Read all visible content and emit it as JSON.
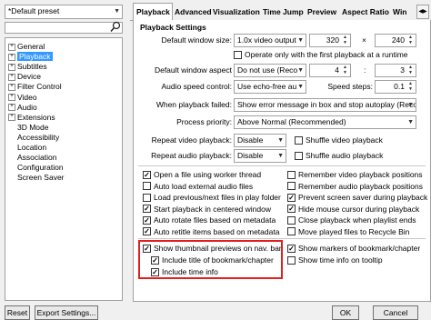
{
  "preset": {
    "value": "*Default preset"
  },
  "search": {
    "icon": "magnifier"
  },
  "tree": {
    "items": [
      {
        "label": "General",
        "expandable": true
      },
      {
        "label": "Playback",
        "expandable": true,
        "selected": true
      },
      {
        "label": "Subtitles",
        "expandable": true
      },
      {
        "label": "Device",
        "expandable": true
      },
      {
        "label": "Filter Control",
        "expandable": true
      },
      {
        "label": "Video",
        "expandable": true
      },
      {
        "label": "Audio",
        "expandable": true
      },
      {
        "label": "Extensions",
        "expandable": true
      },
      {
        "label": "3D Mode",
        "expandable": false
      },
      {
        "label": "Accessibility",
        "expandable": false
      },
      {
        "label": "Location",
        "expandable": false
      },
      {
        "label": "Association",
        "expandable": false
      },
      {
        "label": "Configuration",
        "expandable": false
      },
      {
        "label": "Screen Saver",
        "expandable": false
      }
    ]
  },
  "tabs": [
    "Playback",
    "Advanced",
    "Visualization",
    "Time Jump",
    "Preview",
    "Aspect Ratio",
    "Win"
  ],
  "settings": {
    "group_label": "Playback Settings",
    "window_size_label": "Default window size:",
    "window_size_value": "1.0x video output",
    "width_value": "320",
    "times": "×",
    "height_value": "240",
    "operate_only_label": "Operate only with the first playback at a runtime",
    "aspect_label": "Default window aspect",
    "aspect_value": "Do not use (Reco",
    "aspect_w": "4",
    "aspect_colon": ":",
    "aspect_h": "3",
    "audio_speed_label": "Audio speed control:",
    "audio_speed_value": "Use echo-free au",
    "speed_steps_label": "Speed steps:",
    "speed_steps_value": "0.1",
    "failed_label": "When playback failed:",
    "failed_value": "Show error message in box and stop autoplay (Reco",
    "priority_label": "Process priority:",
    "priority_value": "Above Normal (Recommended)",
    "repeat_video_label": "Repeat video playback:",
    "repeat_video_value": "Disable",
    "shuffle_video_label": "Shuffle video playback",
    "repeat_audio_label": "Repeat audio playback:",
    "repeat_audio_value": "Disable",
    "shuffle_audio_label": "Shuffle audio playback"
  },
  "checks_left": [
    {
      "label": "Open a file using worker thread",
      "checked": true
    },
    {
      "label": "Auto load external audio files",
      "checked": false
    },
    {
      "label": "Load previous/next files in play folder",
      "checked": false
    },
    {
      "label": "Start playback in centered window",
      "checked": true
    },
    {
      "label": "Auto rotate files based on metadata",
      "checked": true
    },
    {
      "label": "Auto retitle items based on metadata",
      "checked": true
    }
  ],
  "checks_right": [
    {
      "label": "Remember video playback positions",
      "checked": false
    },
    {
      "label": "Remember audio playback positions",
      "checked": false
    },
    {
      "label": "Prevent screen saver during playback",
      "checked": true
    },
    {
      "label": "Hide mouse cursor during playback",
      "checked": true
    },
    {
      "label": "Close playback when playlist ends",
      "checked": false
    },
    {
      "label": "Move played files to Recycle Bin",
      "checked": false
    }
  ],
  "highlighted": {
    "show_thumbs": "Show thumbnail previews on nav. bar",
    "include_title": "Include title of bookmark/chapter",
    "include_time": "Include time info",
    "highlight_color": "#e02020"
  },
  "checks_extra_right": [
    {
      "label": "Show markers of bookmark/chapter",
      "checked": true
    },
    {
      "label": "Show time info on tooltip",
      "checked": false
    }
  ],
  "buttons": {
    "reset": "Reset",
    "export": "Export Settings...",
    "ok": "OK",
    "cancel": "Cancel"
  }
}
